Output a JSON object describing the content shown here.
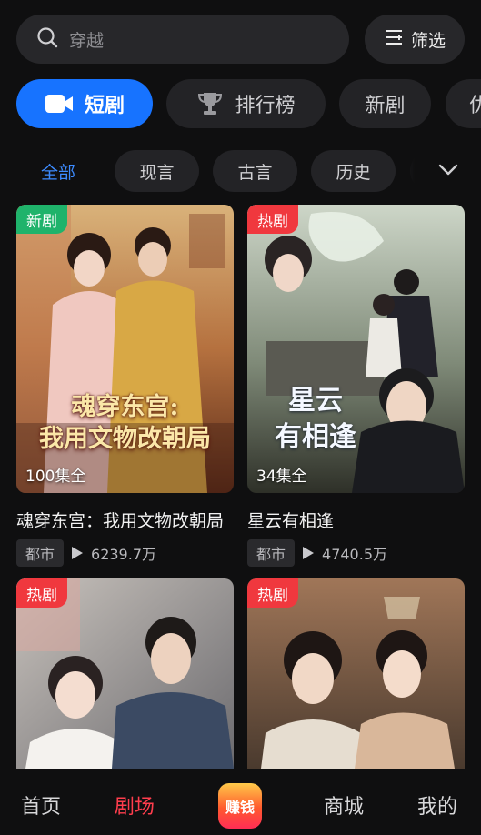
{
  "search": {
    "text": "穿越",
    "icon": "search-icon"
  },
  "filter": {
    "label": "筛选",
    "icon": "filter-icon"
  },
  "main_tabs": [
    {
      "label": "短剧",
      "icon": "video-camera-icon",
      "active": true
    },
    {
      "label": "排行榜",
      "icon": "trophy-icon",
      "active": false
    },
    {
      "label": "新剧",
      "active": false
    },
    {
      "label": "优",
      "active": false
    }
  ],
  "sub_tabs": [
    {
      "label": "全部",
      "active": true
    },
    {
      "label": "现言"
    },
    {
      "label": "古言"
    },
    {
      "label": "历史"
    }
  ],
  "cards": [
    {
      "badge": "新剧",
      "badge_type": "new",
      "episodes": "100集全",
      "title": "魂穿东宫：我用文物改朝局",
      "genre": "都市",
      "plays": "6239.7万",
      "poster_title_line1": "魂穿东宫:",
      "poster_title_line2": "我用文物改朝局"
    },
    {
      "badge": "热剧",
      "badge_type": "hot",
      "episodes": "34集全",
      "title": "星云有相逢",
      "genre": "都市",
      "plays": "4740.5万",
      "poster_title_line1": "星云",
      "poster_title_line2": "有相逢"
    },
    {
      "badge": "热剧",
      "badge_type": "hot"
    },
    {
      "badge": "热剧",
      "badge_type": "hot"
    }
  ],
  "bottom_nav": [
    {
      "label": "首页",
      "active": false
    },
    {
      "label": "剧场",
      "active": true
    },
    {
      "label": "赚钱",
      "active": false
    },
    {
      "label": "商城",
      "active": false
    },
    {
      "label": "我的",
      "active": false
    }
  ],
  "colors": {
    "accent": "#1773ff",
    "active_nav": "#ff3d4d",
    "badge_new": "#1fb36b",
    "badge_hot": "#f0383e"
  }
}
